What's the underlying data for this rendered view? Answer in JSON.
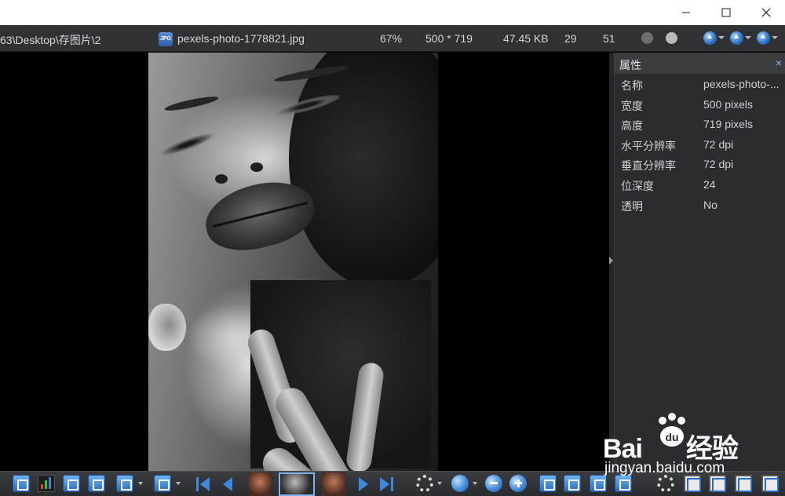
{
  "window": {
    "minimize_label": "",
    "maximize_label": "",
    "close_label": ""
  },
  "infobar": {
    "path": "63\\Desktop\\存图片\\2",
    "file_icon_text": "JPG",
    "filename": "pexels-photo-1778821.jpg",
    "zoom": "67%",
    "dimensions": "500 * 719",
    "filesize": "47.45 KB",
    "index": "29",
    "total": "51",
    "icons": [
      "record-dot-icon",
      "record-dot-light-icon",
      "nav-up-icon",
      "nav-up-icon",
      "nav-up-icon"
    ],
    "colors": {
      "dot_dark": "#6d6e71",
      "dot_light": "#b9babd",
      "accent": "#3b8ae0"
    }
  },
  "properties": {
    "title": "属性",
    "close": "×",
    "rows": [
      {
        "key": "名称",
        "value": "pexels-photo-..."
      },
      {
        "key": "宽度",
        "value": "500 pixels"
      },
      {
        "key": "高度",
        "value": "719 pixels"
      },
      {
        "key": "水平分辨率",
        "value": "72 dpi"
      },
      {
        "key": "垂直分辨率",
        "value": "72 dpi"
      },
      {
        "key": "位深度",
        "value": "24"
      },
      {
        "key": "透明",
        "value": "No"
      }
    ]
  },
  "toolbar": {
    "icons": [
      "fit-icon",
      "histogram-icon",
      "crop-icon",
      "edit-image-icon",
      "pen-icon",
      "export-icon",
      "first-image-icon",
      "previous-image-icon",
      "thumbnail",
      "thumbnail",
      "thumbnail",
      "next-image-icon",
      "last-image-icon",
      "settings-icon",
      "zoom-icon",
      "zoom-out-icon",
      "zoom-in-icon",
      "fit-window-icon",
      "actual-size-icon",
      "fit-width-icon",
      "fit-height-icon",
      "gear-icon",
      "layout-icon",
      "grid-icon",
      "eye-icon",
      "fullscreen-icon"
    ]
  },
  "watermark": {
    "brand_a": "Bai",
    "brand_b": "经验",
    "site": "jingyan.baidu.com"
  }
}
